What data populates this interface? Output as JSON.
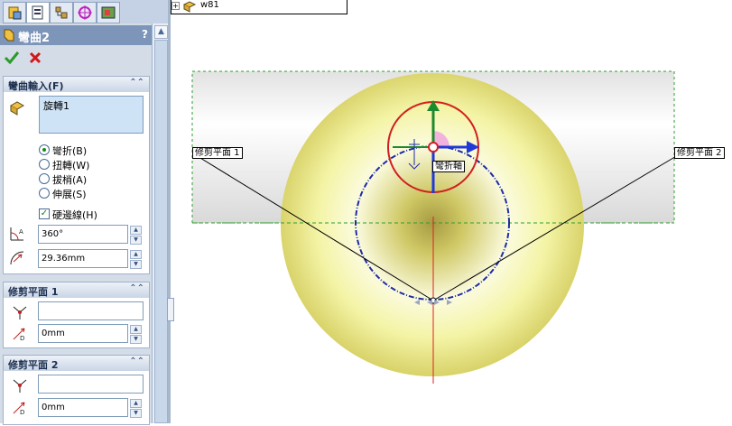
{
  "feature_title": "彎曲2",
  "help_label": "?",
  "ok_icon": "checkmark-icon",
  "cancel_icon": "x-icon",
  "tree": {
    "expander": "+",
    "item": "w81"
  },
  "bend_input": {
    "header": "彎曲輸入(F)",
    "selection": "旋轉1",
    "options": [
      {
        "label": "彎折(B)",
        "selected": true
      },
      {
        "label": "扭轉(W)",
        "selected": false
      },
      {
        "label": "拔梢(A)",
        "selected": false
      },
      {
        "label": "伸展(S)",
        "selected": false
      }
    ],
    "hard_edges": {
      "label": "硬邊線(H)",
      "checked": true
    },
    "angle": "360°",
    "radius": "29.36mm"
  },
  "trim_plane_1": {
    "header": "修剪平面 1",
    "reference": "",
    "distance": "0mm"
  },
  "trim_plane_2": {
    "header": "修剪平面 2",
    "reference": "",
    "distance": "0mm"
  },
  "viewport": {
    "trim_label_1": "修剪平面 1",
    "trim_label_2": "修剪平面 2",
    "bend_axis_label": "彎折軸"
  },
  "colors": {
    "part": "#f3f3a0",
    "triad_x": "#1f3ad8",
    "triad_y": "#1e8a2e",
    "ring": "#d02020",
    "frame": "#2da02d"
  }
}
